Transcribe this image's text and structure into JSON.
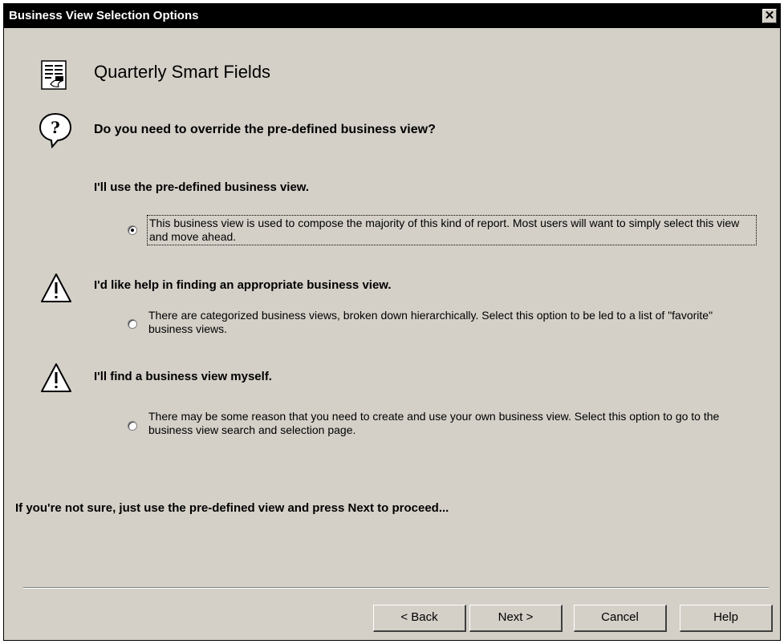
{
  "window": {
    "title": "Business View Selection Options",
    "close_glyph": "✕"
  },
  "header": {
    "title": "Quarterly Smart Fields",
    "icon": "document-icon"
  },
  "question": {
    "icon": "question-icon",
    "text": "Do you need to override the pre-defined business view?"
  },
  "options": [
    {
      "heading": "I'll use the pre-defined business view.",
      "description": "This business view is used to compose the majority of this kind of report.  Most users will want to simply select this view and move ahead.",
      "selected": true
    },
    {
      "heading": "I'd like help in finding an appropriate business view.",
      "description": "There are categorized business views, broken down hierarchically.  Select this option to be led to a list of \"favorite\" business views.",
      "selected": false,
      "icon": "warning-icon"
    },
    {
      "heading": "I'll find a business view myself.",
      "description": "There may be some reason that you need to create and use your own business view.  Select this option to go to the business view search and selection page.",
      "selected": false,
      "icon": "warning-icon"
    }
  ],
  "hint": "If you're not sure, just use the pre-defined view and press Next to proceed...",
  "buttons": {
    "back": "< Back",
    "next": "Next >",
    "cancel": "Cancel",
    "help": "Help"
  },
  "colors": {
    "dialog_bg": "#d4d0c8",
    "titlebar_bg": "#000000",
    "titlebar_text": "#ffffff"
  }
}
